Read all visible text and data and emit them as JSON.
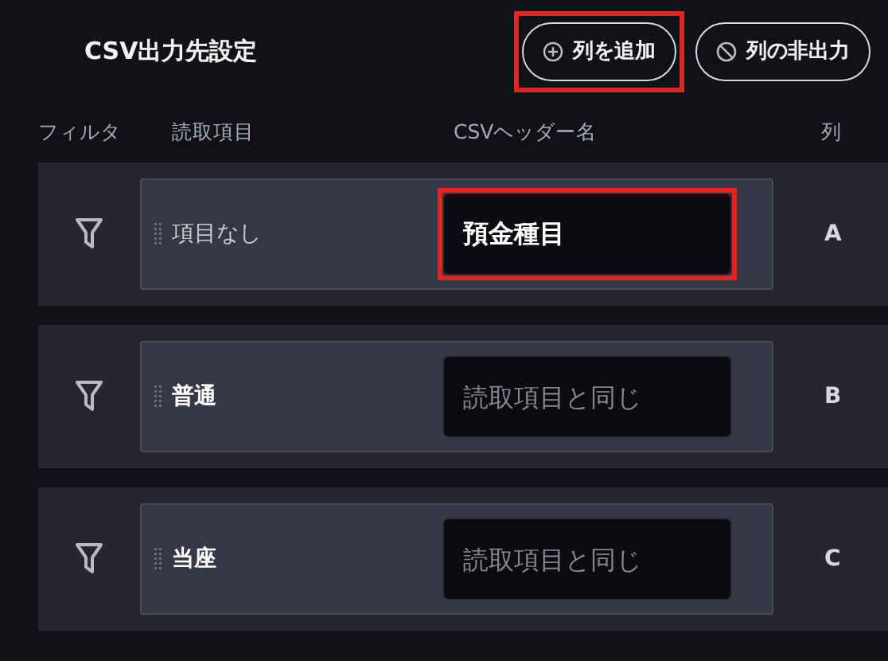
{
  "title": "CSV出力先設定",
  "buttons": [
    {
      "kind": "add",
      "label": "列を追加",
      "highlighted": true
    },
    {
      "kind": "hide",
      "label": "列の非出力",
      "highlighted": false
    }
  ],
  "columns": [
    "フィルタ",
    "読取項目",
    "CSVヘッダー名",
    "列"
  ],
  "rows": [
    {
      "source": "項目なし",
      "source_empty": true,
      "header_value": "預金種目",
      "header_placeholder": "",
      "highlighted": true,
      "column": "A"
    },
    {
      "source": "普通",
      "source_empty": false,
      "header_placeholder": "読取項目と同じ",
      "highlighted": false,
      "column": "B"
    },
    {
      "source": "当座",
      "source_empty": false,
      "header_placeholder": "読取項目と同じ",
      "highlighted": false,
      "column": "C"
    }
  ]
}
